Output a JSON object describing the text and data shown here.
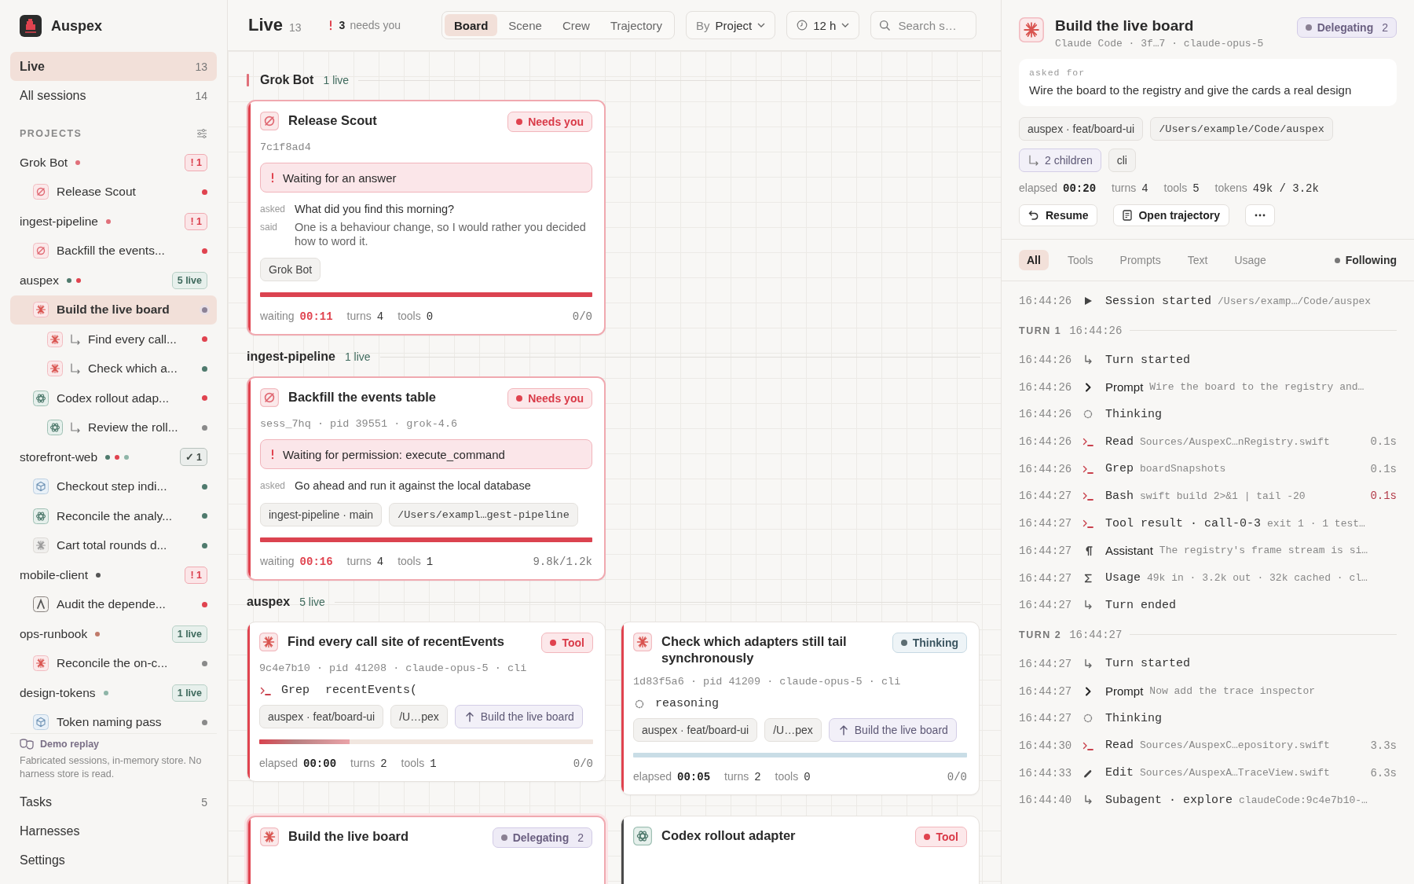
{
  "app": {
    "name": "Auspex"
  },
  "sidebar": {
    "nav": [
      {
        "label": "Live",
        "count": "13",
        "selected": true
      },
      {
        "label": "All sessions",
        "count": "14",
        "selected": false
      }
    ],
    "projects_heading": "PROJECTS",
    "projects": [
      {
        "name": "Grok Bot",
        "dots": [
          {
            "color": "#e0707a"
          }
        ],
        "badge": {
          "kind": "alert",
          "text": "! 1"
        },
        "sessions": [
          {
            "title": "Release Scout",
            "kind": "grok",
            "color": "#e0434f",
            "selected": false
          }
        ]
      },
      {
        "name": "ingest-pipeline",
        "dots": [
          {
            "color": "#e0707a"
          }
        ],
        "badge": {
          "kind": "alert",
          "text": "! 1"
        },
        "sessions": [
          {
            "title": "Backfill the events...",
            "kind": "grok",
            "color": "#e0434f",
            "selected": false
          }
        ]
      },
      {
        "name": "auspex",
        "dots": [
          {
            "color": "#4f7a6d"
          },
          {
            "color": "#e0434f"
          }
        ],
        "badge": {
          "kind": "live",
          "text": "5 live"
        },
        "sessions": [
          {
            "title": "Build the live board",
            "kind": "claude",
            "color": "#8c8296",
            "selected": true,
            "children": [
              {
                "title": "Find every call...",
                "kind": "claude",
                "color": "#e0434f",
                "selected": false
              },
              {
                "title": "Check which a...",
                "kind": "claude",
                "color": "#4f7a6d",
                "selected": false
              }
            ]
          },
          {
            "title": "Codex rollout adap...",
            "kind": "openai",
            "color": "#e0434f",
            "selected": false,
            "children": [
              {
                "title": "Review the roll...",
                "kind": "openai",
                "color": "#8a8a8a",
                "selected": false
              }
            ]
          }
        ]
      },
      {
        "name": "storefront-web",
        "dots": [
          {
            "color": "#4f7a6d"
          },
          {
            "color": "#e0434f"
          },
          {
            "color": "#8fb5a8"
          }
        ],
        "badge": {
          "kind": "done",
          "text": "✓ 1"
        },
        "sessions": [
          {
            "title": "Checkout step indi...",
            "kind": "cube",
            "color": "#4f7a6d",
            "selected": false
          },
          {
            "title": "Reconcile the analy...",
            "kind": "openai",
            "color": "#4f7a6d",
            "selected": false
          },
          {
            "title": "Cart total rounds d...",
            "kind": "spark",
            "color": "#4f7a6d",
            "selected": false
          }
        ]
      },
      {
        "name": "mobile-client",
        "dots": [
          {
            "color": "#555555"
          }
        ],
        "badge": {
          "kind": "alert",
          "text": "! 1"
        },
        "sessions": [
          {
            "title": "Audit the depende...",
            "kind": "mountain",
            "color": "#e0434f",
            "selected": false
          }
        ]
      },
      {
        "name": "ops-runbook",
        "dots": [
          {
            "color": "#c07a6a"
          }
        ],
        "badge": {
          "kind": "live",
          "text": "1 live"
        },
        "sessions": [
          {
            "title": "Reconcile the on-c...",
            "kind": "claude",
            "color": "#8a8a8a",
            "selected": false
          }
        ]
      },
      {
        "name": "design-tokens",
        "dots": [
          {
            "color": "#8fb5a8"
          }
        ],
        "badge": {
          "kind": "live",
          "text": "1 live"
        },
        "sessions": [
          {
            "title": "Token naming pass",
            "kind": "cube",
            "color": "#8a8a8a",
            "selected": false
          }
        ]
      }
    ],
    "demo": {
      "title": "Demo replay",
      "text": "Fabricated sessions, in-memory store. No harness store is read."
    },
    "footer_nav": [
      {
        "label": "Tasks",
        "count": "5"
      },
      {
        "label": "Harnesses"
      },
      {
        "label": "Settings"
      }
    ]
  },
  "header": {
    "title": "Live",
    "count": "13",
    "alert_count": "3",
    "alert_text": "needs you",
    "tabs": [
      {
        "label": "Board",
        "selected": true
      },
      {
        "label": "Scene",
        "selected": false
      },
      {
        "label": "Crew",
        "selected": false
      },
      {
        "label": "Trajectory",
        "selected": false
      }
    ],
    "group_by": {
      "prefix": "By",
      "value": "Project"
    },
    "window": {
      "value": "12 h"
    },
    "search": {
      "placeholder": "Search s…"
    }
  },
  "groups": [
    {
      "name": "Grok Bot",
      "count": "1 live",
      "marked": true,
      "cards": [
        {
          "title": "Release Scout",
          "kind": "grok",
          "status": {
            "kind": "needs",
            "label": "Needs you"
          },
          "color": "#e0434f",
          "selected": false,
          "meta": "7c1f8ad4",
          "alert": "Waiting for an answer",
          "exchange": [
            {
              "role": "asked",
              "text": "What did you find this morning?"
            },
            {
              "role": "said",
              "text": "One is a behaviour change, so I would rather you decided how to word it."
            }
          ],
          "tags": [
            {
              "kind": "plain",
              "text": "Grok Bot"
            }
          ],
          "bar": {
            "kind": "solid",
            "level": 1
          },
          "stats": [
            {
              "label": "waiting",
              "value": "00:11",
              "kind": "alert"
            },
            {
              "label": "turns",
              "value": "4",
              "kind": "plain"
            },
            {
              "label": "tools",
              "value": "0",
              "kind": "plain"
            }
          ],
          "tokens": "0/0"
        }
      ]
    },
    {
      "name": "ingest-pipeline",
      "count": "1 live",
      "marked": false,
      "cards": [
        {
          "title": "Backfill the events table",
          "kind": "grok",
          "status": {
            "kind": "needs",
            "label": "Needs you"
          },
          "color": "#e0434f",
          "selected": false,
          "meta": "sess_7hq · pid 39551 · grok-4.6",
          "alert": "Waiting for permission: execute_command",
          "exchange": [
            {
              "role": "asked",
              "text": "Go ahead and run it against the local database"
            }
          ],
          "tags": [
            {
              "kind": "plain",
              "text": "ingest-pipeline · main"
            },
            {
              "kind": "mono",
              "text": "/Users/exampl…gest-pipeline"
            }
          ],
          "bar": {
            "kind": "solid",
            "level": 1
          },
          "stats": [
            {
              "label": "waiting",
              "value": "00:16",
              "kind": "alert"
            },
            {
              "label": "turns",
              "value": "4",
              "kind": "plain"
            },
            {
              "label": "tools",
              "value": "1",
              "kind": "plain"
            }
          ],
          "tokens": "9.8k/1.2k"
        }
      ]
    },
    {
      "name": "auspex",
      "count": "5 live",
      "marked": false,
      "cards": [
        {
          "title": "Find every call site of recentEvents",
          "kind": "claude",
          "status": {
            "kind": "tool",
            "label": "Tool"
          },
          "color": "#e0434f",
          "selected": false,
          "meta": "9c4e7b10 · pid 41208 · claude-opus-5 · cli",
          "activity": {
            "kind": "terminal",
            "name": "Grep",
            "arg": "recentEvents("
          },
          "tags": [
            {
              "kind": "plain",
              "text": "auspex · feat/board-ui"
            },
            {
              "kind": "plain",
              "text": "/U…pex"
            },
            {
              "kind": "parent",
              "text": "Build the live board"
            }
          ],
          "bar": {
            "kind": "gradient",
            "level": 0.27
          },
          "stats": [
            {
              "label": "elapsed",
              "value": "00:00",
              "kind": "strong"
            },
            {
              "label": "turns",
              "value": "2",
              "kind": "plain"
            },
            {
              "label": "tools",
              "value": "1",
              "kind": "plain"
            }
          ],
          "tokens": "0/0"
        },
        {
          "title": "Check which adapters still tail synchronously",
          "kind": "claude",
          "status": {
            "kind": "thinking",
            "label": "Thinking"
          },
          "color": "#e0434f",
          "selected": false,
          "meta": "1d83f5a6 · pid 41209 · claude-opus-5 · cli",
          "activity": {
            "kind": "thinking",
            "name": "reasoning"
          },
          "tags": [
            {
              "kind": "plain",
              "text": "auspex · feat/board-ui"
            },
            {
              "kind": "plain",
              "text": "/U…pex"
            },
            {
              "kind": "parent",
              "text": "Build the live board"
            }
          ],
          "bar": {
            "kind": "thinking",
            "level": 1
          },
          "stats": [
            {
              "label": "elapsed",
              "value": "00:05",
              "kind": "strong"
            },
            {
              "label": "turns",
              "value": "2",
              "kind": "plain"
            },
            {
              "label": "tools",
              "value": "0",
              "kind": "plain"
            }
          ],
          "tokens": "0/0"
        },
        {
          "title": "Build the live board",
          "kind": "claude",
          "status": {
            "kind": "delegating",
            "label": "Delegating",
            "count": "2"
          },
          "color": "#e0434f",
          "selected": true
        },
        {
          "title": "Codex rollout adapter",
          "kind": "openai",
          "status": {
            "kind": "tool",
            "label": "Tool"
          },
          "color": "#4a4a4a",
          "selected": false
        }
      ]
    }
  ],
  "inspector": {
    "title": "Build the live board",
    "kind": "claude",
    "subtitle": "Claude Code · 3f…7 · claude-opus-5",
    "status": {
      "kind": "delegating",
      "label": "Delegating",
      "count": "2"
    },
    "asked_label": "asked for",
    "asked_text": "Wire the board to the registry and give the cards a real design",
    "tags": [
      {
        "kind": "plain",
        "text": "auspex · feat/board-ui"
      },
      {
        "kind": "mono",
        "text": "/Users/example/Code/auspex"
      },
      {
        "kind": "children",
        "text": "2 children"
      },
      {
        "kind": "plain",
        "text": "cli"
      }
    ],
    "stats": [
      {
        "label": "elapsed",
        "value": "00:20",
        "kind": "strong"
      },
      {
        "label": "turns",
        "value": "4",
        "kind": "plain"
      },
      {
        "label": "tools",
        "value": "5",
        "kind": "plain"
      },
      {
        "label": "tokens",
        "value": "49k / 3.2k",
        "kind": "plain"
      }
    ],
    "buttons": [
      {
        "kind": "resume",
        "label": "Resume"
      },
      {
        "kind": "trajectory",
        "label": "Open trajectory"
      },
      {
        "kind": "more"
      }
    ],
    "filters": [
      {
        "label": "All",
        "selected": true
      },
      {
        "label": "Tools",
        "selected": false
      },
      {
        "label": "Prompts",
        "selected": false
      },
      {
        "label": "Text",
        "selected": false
      },
      {
        "label": "Usage",
        "selected": false
      }
    ],
    "following": "Following",
    "events": [
      {
        "kind": "play",
        "time": "16:44:26",
        "name": "Session started",
        "detail": "/Users/examp…/Code/auspex"
      },
      {
        "kind": "turn_header",
        "label": "TURN 1",
        "time": "16:44:26"
      },
      {
        "kind": "turn",
        "time": "16:44:26",
        "name": "Turn started"
      },
      {
        "kind": "prompt",
        "time": "16:44:26",
        "name": "Prompt",
        "detail": "Wire the board to the registry and…"
      },
      {
        "kind": "thinking",
        "time": "16:44:26",
        "name": "Thinking"
      },
      {
        "kind": "terminal",
        "time": "16:44:26",
        "name": "Read",
        "detail": "Sources/AuspexC…nRegistry.swift",
        "duration": "0.1s",
        "error": false
      },
      {
        "kind": "terminal",
        "time": "16:44:26",
        "name": "Grep",
        "detail": "boardSnapshots",
        "duration": "0.1s",
        "error": false
      },
      {
        "kind": "terminal",
        "time": "16:44:27",
        "name": "Bash",
        "detail": "swift build 2>&1 | tail -20",
        "duration": "0.1s",
        "error": true
      },
      {
        "kind": "terminal",
        "time": "16:44:27",
        "name": "Tool result · call-0-3",
        "detail": "exit 1 · 1 test…"
      },
      {
        "kind": "pilcrow",
        "time": "16:44:27",
        "name": "Assistant",
        "detail": "The registry's frame stream is si…"
      },
      {
        "kind": "sigma",
        "time": "16:44:27",
        "name": "Usage",
        "detail": "49k in · 3.2k out · 32k cached · cl…"
      },
      {
        "kind": "turn",
        "time": "16:44:27",
        "name": "Turn ended"
      },
      {
        "kind": "turn_header",
        "label": "TURN 2",
        "time": "16:44:27"
      },
      {
        "kind": "turn",
        "time": "16:44:27",
        "name": "Turn started"
      },
      {
        "kind": "prompt",
        "time": "16:44:27",
        "name": "Prompt",
        "detail": "Now add the trace inspector"
      },
      {
        "kind": "thinking",
        "time": "16:44:27",
        "name": "Thinking"
      },
      {
        "kind": "terminal",
        "time": "16:44:30",
        "name": "Read",
        "detail": "Sources/AuspexC…epository.swift",
        "duration": "3.3s",
        "error": false
      },
      {
        "kind": "pencil",
        "time": "16:44:33",
        "name": "Edit",
        "detail": "Sources/AuspexA…TraceView.swift",
        "duration": "6.3s",
        "error": false
      },
      {
        "kind": "turn",
        "time": "16:44:40",
        "name": "Subagent · explore",
        "detail": "claudeCode:9c4e7b10-…"
      }
    ]
  }
}
